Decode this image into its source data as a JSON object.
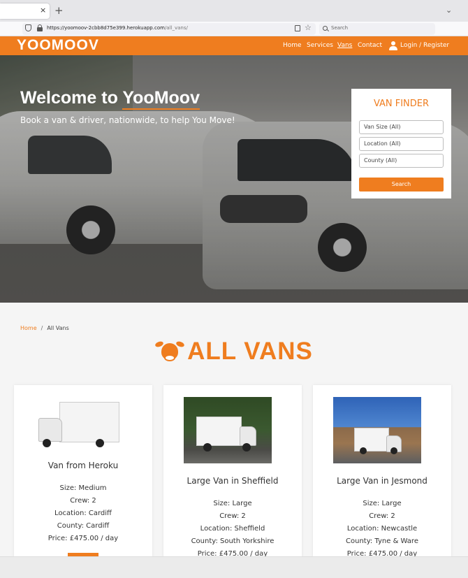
{
  "browser": {
    "close_glyph": "×",
    "new_tab_glyph": "+",
    "menu_glyph": "⌄",
    "url_host": "https://yoomoov-2cbb8d75e399.herokuapp.com",
    "url_path": "/all_vans/",
    "search_placeholder": "Search"
  },
  "header": {
    "logo": "YOOMOOV",
    "nav": [
      "Home",
      "Services",
      "Vans",
      "Contact"
    ],
    "active_nav": "Vans",
    "login": "Login / Register",
    "accent_color": "#ef7d1f"
  },
  "hero": {
    "title_prefix": "Welcome to ",
    "title_brand": "YooMoov",
    "subtitle": "Book a van & driver, nationwide, to help You Move!"
  },
  "finder": {
    "title": "VAN FINDER",
    "size": "Van Size (All)",
    "location": "Location (All)",
    "county": "County (All)",
    "button": "Search"
  },
  "breadcrumb": {
    "home": "Home",
    "separator": "/",
    "current": "All Vans"
  },
  "section": {
    "title": "ALL VANS"
  },
  "cards": [
    {
      "name": "Van from Heroku",
      "size": "Size: Medium",
      "crew": "Crew: 2",
      "location": "Location: Cardiff",
      "county": "County: Cardiff",
      "price": "Price: £475.00 / day"
    },
    {
      "name": "Large Van in Sheffield",
      "size": "Size: Large",
      "crew": "Crew: 2",
      "location": "Location: Sheffield",
      "county": "County: South Yorkshire",
      "price": "Price: £475.00 / day"
    },
    {
      "name": "Large Van in Jesmond",
      "size": "Size: Large",
      "crew": "Crew: 2",
      "location": "Location: Newcastle",
      "county": "County: Tyne & Ware",
      "price": "Price: £475.00 / day"
    }
  ]
}
